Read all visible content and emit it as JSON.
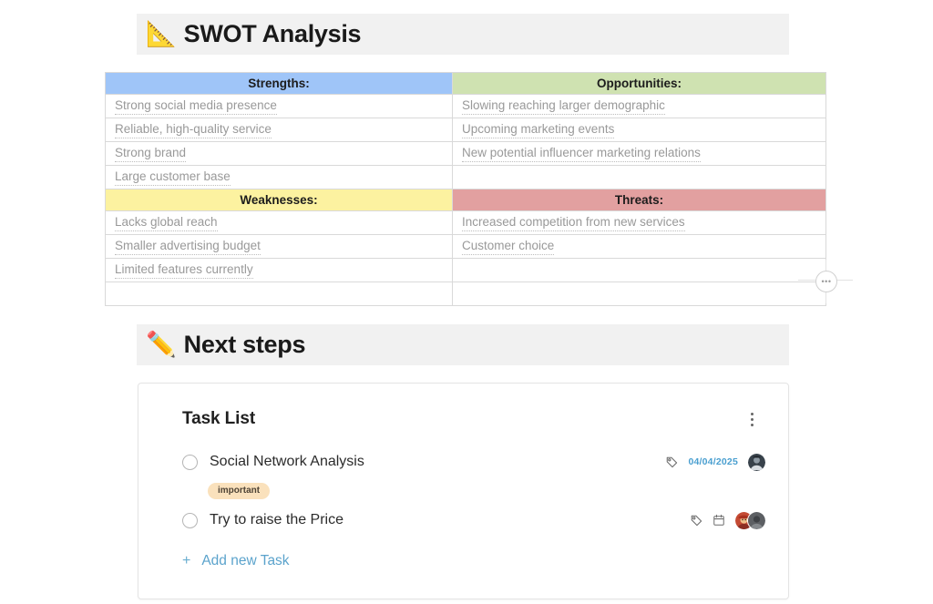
{
  "sections": {
    "swot": {
      "emoji": "📐",
      "emoji_name": "triangular-ruler-icon",
      "title": "SWOT Analysis"
    },
    "next_steps": {
      "emoji": "✏️",
      "emoji_name": "pencil-icon",
      "title": "Next steps"
    }
  },
  "swot": {
    "colors": {
      "strengths": "#9fc5f8",
      "opportunities": "#cfe2b1",
      "weaknesses": "#fcf2a0",
      "threats": "#e2a0a0"
    },
    "quadrants": {
      "strengths": {
        "heading": "Strengths:",
        "items": [
          "Strong social media presence",
          "Reliable, high-quality service",
          "Strong brand",
          "Large customer base"
        ]
      },
      "opportunities": {
        "heading": "Opportunities:",
        "items": [
          "Slowing reaching larger demographic",
          "Upcoming marketing events",
          "New potential influencer marketing relations",
          ""
        ]
      },
      "weaknesses": {
        "heading": "Weaknesses:",
        "items": [
          "Lacks global reach",
          "Smaller advertising budget",
          "Limited features currently",
          ""
        ]
      },
      "threats": {
        "heading": "Threats:",
        "items": [
          "Increased competition from new services",
          "Customer choice",
          "",
          ""
        ]
      }
    },
    "handle_label": "•••"
  },
  "task_card": {
    "title": "Task List",
    "menu_name": "more-options",
    "tasks": [
      {
        "title": "Social Network Analysis",
        "checked": false,
        "date": "04/04/2025",
        "has_tag_icon": true,
        "has_calendar_icon": false,
        "tag": "important",
        "assignees": 1
      },
      {
        "title": "Try to raise the Price",
        "checked": false,
        "date": "",
        "has_tag_icon": true,
        "has_calendar_icon": true,
        "tag": "",
        "assignees": 2
      }
    ],
    "add_task": {
      "plus": "+",
      "label": "Add new Task"
    },
    "accent_color": "#5ba3cc",
    "tag_color": "#fae1bc"
  }
}
